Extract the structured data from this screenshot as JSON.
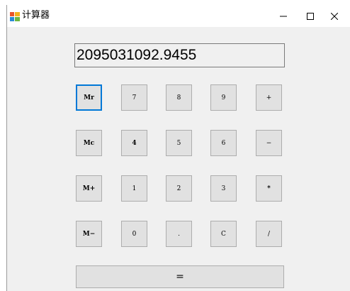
{
  "window": {
    "title": "计算器",
    "icon": "calculator-app-icon",
    "controls": {
      "minimize_icon": "minimize-icon",
      "maximize_icon": "maximize-icon",
      "close_icon": "close-icon"
    }
  },
  "display": {
    "value": "2095031092.9455"
  },
  "keys": {
    "row1": {
      "mr": "Mr",
      "seven": "7",
      "eight": "8",
      "nine": "9",
      "plus": "+"
    },
    "row2": {
      "mc": "Mc",
      "four": "4",
      "five": "5",
      "six": "6",
      "minus": "−"
    },
    "row3": {
      "mplus": "M+",
      "one": "1",
      "two": "2",
      "three": "3",
      "multiply": "*"
    },
    "row4": {
      "mminus": "M−",
      "zero": "0",
      "dot": ".",
      "clear": "C",
      "divide": "/"
    },
    "equals": "="
  },
  "colors": {
    "focus_accent": "#0078d7",
    "button_face": "#e1e1e1",
    "window_bg": "#f0f0f0"
  }
}
